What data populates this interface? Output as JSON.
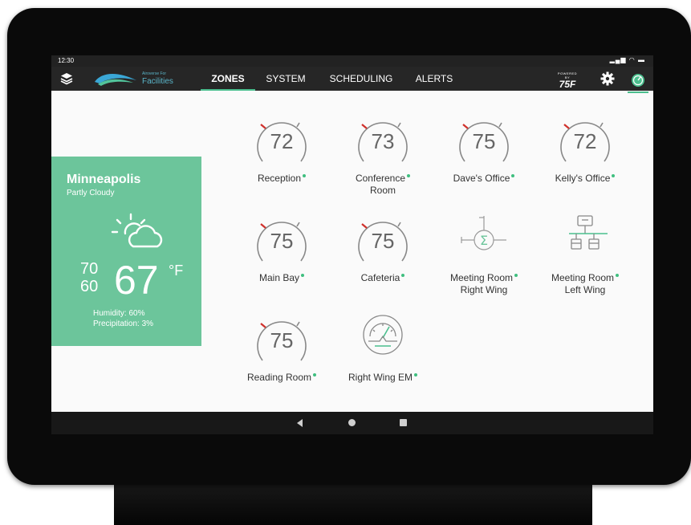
{
  "status_bar": {
    "time": "12:30",
    "icons": [
      "signal-icon",
      "wifi-icon",
      "battery-icon"
    ]
  },
  "header": {
    "logo_small": "Airoverse For",
    "logo_big": "Facilities",
    "tabs": [
      {
        "label": "ZONES",
        "active": true
      },
      {
        "label": "SYSTEM",
        "active": false
      },
      {
        "label": "SCHEDULING",
        "active": false
      },
      {
        "label": "ALERTS",
        "active": false
      }
    ],
    "powered_small": "POWERED BY",
    "powered_brand": "75F"
  },
  "weather": {
    "city": "Minneapolis",
    "condition": "Partly Cloudy",
    "high": "70",
    "low": "60",
    "current": "67",
    "unit": "°F",
    "humidity": "Humidity: 60%",
    "precipitation": "Precipitation: 3%"
  },
  "zones": [
    {
      "kind": "dial",
      "value": "72",
      "line1": "Reception",
      "line2": ""
    },
    {
      "kind": "dial",
      "value": "73",
      "line1": "Conference",
      "line2": "Room"
    },
    {
      "kind": "dial",
      "value": "75",
      "line1": "Dave's Office",
      "line2": ""
    },
    {
      "kind": "dial",
      "value": "72",
      "line1": "Kelly's Office",
      "line2": ""
    },
    {
      "kind": "dial",
      "value": "75",
      "line1": "Main Bay",
      "line2": ""
    },
    {
      "kind": "dial",
      "value": "75",
      "line1": "Cafeteria",
      "line2": ""
    },
    {
      "kind": "sum-icon",
      "line1": "Meeting Room",
      "line2": "Right Wing"
    },
    {
      "kind": "network-icon",
      "line1": "Meeting Room",
      "line2": "Left Wing"
    },
    {
      "kind": "dial",
      "value": "75",
      "line1": "Reading Room",
      "line2": ""
    },
    {
      "kind": "meter-icon",
      "line1": "Right Wing EM",
      "line2": ""
    }
  ],
  "colors": {
    "accent": "#4bbf8e",
    "weather_panel": "#6cc59b",
    "setpoint_red": "#d0302b",
    "status_dot": "#3fbf7f"
  }
}
